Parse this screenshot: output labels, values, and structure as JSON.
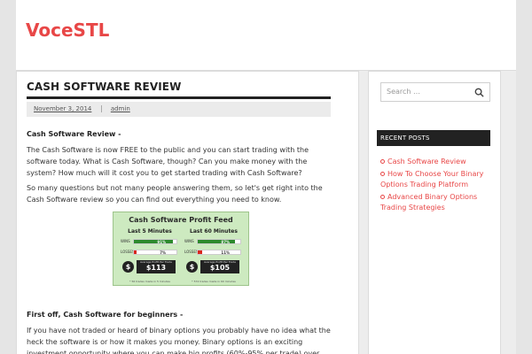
{
  "site": {
    "title": "VoceSTL"
  },
  "post": {
    "title": "CASH SOFTWARE REVIEW",
    "date": "November 3, 2014",
    "author": "admin",
    "heading1": "Cash Software Review -",
    "para1": "The Cash Software is now FREE to the public and you can start trading with the software today. What is Cash Software, though? Can you make money with the system? How much will it cost you to get started trading with Cash Software?",
    "para2": "So many questions but not many people answering them, so let's get right into the Cash Software review so you can find out everything you need to know.",
    "heading2": "First off, Cash Software for beginners -",
    "para3": "If you have not traded or heard of binary options you probably have no idea what the heck the software is or how it makes you money. Binary options is an exciting investment opportunity where you can make big profits (60%-95% per trade) over"
  },
  "feed": {
    "title": "Cash Software Profit Feed",
    "columns": [
      {
        "header": "Last 5 Minutes",
        "wins_label": "WINS",
        "wins_value": "91%",
        "wins_fraction": 0.91,
        "losses_label": "LOSSES",
        "losses_value": "7%",
        "losses_fraction": 0.07,
        "profit_caption": "Average Profit Per Trade",
        "profit": "$113",
        "footer": "* 56 trades made in 5 minutes"
      },
      {
        "header": "Last 60 Minutes",
        "wins_label": "WINS",
        "wins_value": "87%",
        "wins_fraction": 0.87,
        "losses_label": "LOSSES",
        "losses_value": "11%",
        "losses_fraction": 0.11,
        "profit_caption": "Average Profit Per Trade",
        "profit": "$105",
        "footer": "* 574 trades made in 60 minutes"
      }
    ],
    "colors": {
      "win": "#2d8a2d",
      "loss": "#d9261c"
    }
  },
  "sidebar": {
    "search_placeholder": "Search …",
    "recent_title": "RECENT POSTS",
    "recent_posts": [
      "Cash Software Review",
      "How To Choose Your Binary Options Trading Platform",
      "Advanced Binary Options Trading Strategies"
    ]
  },
  "colors": {
    "accent": "#e84747",
    "dark": "#222222"
  }
}
